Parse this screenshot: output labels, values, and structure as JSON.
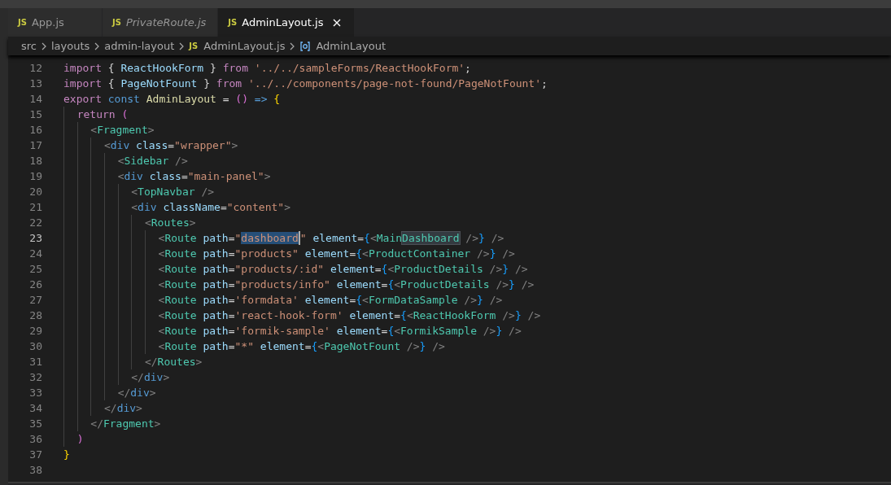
{
  "tabs": [
    {
      "icon_text": "JS",
      "label": "App.js",
      "selected": false,
      "preview": false
    },
    {
      "icon_text": "JS",
      "label": "PrivateRoute.js",
      "selected": false,
      "preview": true
    },
    {
      "icon_text": "JS",
      "label": "AdminLayout.js",
      "selected": true,
      "preview": false
    }
  ],
  "breadcrumb": [
    {
      "kind": "folder",
      "label": "src"
    },
    {
      "kind": "folder",
      "label": "layouts"
    },
    {
      "kind": "folder",
      "label": "admin-layout"
    },
    {
      "kind": "file",
      "icon_text": "JS",
      "label": "AdminLayout.js"
    },
    {
      "kind": "symbol",
      "label": "AdminLayout"
    }
  ],
  "code": {
    "lines": [
      {
        "number": "12",
        "active": false,
        "tokens": [
          {
            "kind": "kw",
            "text": "import"
          },
          {
            "kind": "punct",
            "text": " { "
          },
          {
            "kind": "var",
            "text": "ReactHookForm"
          },
          {
            "kind": "punct",
            "text": " } "
          },
          {
            "kind": "kw",
            "text": "from"
          },
          {
            "kind": "str",
            "text": " '../../sampleForms/ReactHookForm'"
          },
          {
            "kind": "punct",
            "text": ";"
          }
        ]
      },
      {
        "number": "13",
        "active": false,
        "tokens": [
          {
            "kind": "kw",
            "text": "import"
          },
          {
            "kind": "punct",
            "text": " { "
          },
          {
            "kind": "var",
            "text": "PageNotFount"
          },
          {
            "kind": "punct",
            "text": " } "
          },
          {
            "kind": "kw",
            "text": "from"
          },
          {
            "kind": "str",
            "text": " '../../components/page-not-found/PageNotFount'"
          },
          {
            "kind": "punct",
            "text": ";"
          }
        ]
      },
      {
        "number": "14",
        "active": false,
        "tokens": [
          {
            "kind": "kw",
            "text": "export"
          },
          {
            "kind": "storage",
            "text": " const"
          },
          {
            "kind": "fn",
            "text": " AdminLayout"
          },
          {
            "kind": "punct",
            "text": " = "
          },
          {
            "kind": "b2",
            "text": "()"
          },
          {
            "kind": "storage",
            "text": " =>"
          },
          {
            "kind": "b1",
            "text": " {"
          }
        ]
      },
      {
        "number": "15",
        "active": false,
        "tokens": [
          {
            "kind": "kw",
            "text": "  return"
          },
          {
            "kind": "b2",
            "text": " ("
          }
        ]
      },
      {
        "number": "16",
        "active": false,
        "tokens": [
          {
            "kind": "angle",
            "text": "    <"
          },
          {
            "kind": "comp",
            "text": "Fragment"
          },
          {
            "kind": "angle",
            "text": ">"
          }
        ]
      },
      {
        "number": "17",
        "active": false,
        "tokens": [
          {
            "kind": "angle",
            "text": "      <"
          },
          {
            "kind": "html",
            "text": "div"
          },
          {
            "kind": "attr",
            "text": " class"
          },
          {
            "kind": "punct",
            "text": "="
          },
          {
            "kind": "str",
            "text": "\"wrapper\""
          },
          {
            "kind": "angle",
            "text": ">"
          }
        ]
      },
      {
        "number": "18",
        "active": false,
        "tokens": [
          {
            "kind": "angle",
            "text": "        <"
          },
          {
            "kind": "comp",
            "text": "Sidebar"
          },
          {
            "kind": "angle",
            "text": " />"
          }
        ]
      },
      {
        "number": "19",
        "active": false,
        "tokens": [
          {
            "kind": "angle",
            "text": "        <"
          },
          {
            "kind": "html",
            "text": "div"
          },
          {
            "kind": "attr",
            "text": " class"
          },
          {
            "kind": "punct",
            "text": "="
          },
          {
            "kind": "str",
            "text": "\"main-panel\""
          },
          {
            "kind": "angle",
            "text": ">"
          }
        ]
      },
      {
        "number": "20",
        "active": false,
        "tokens": [
          {
            "kind": "angle",
            "text": "          <"
          },
          {
            "kind": "comp",
            "text": "TopNavbar"
          },
          {
            "kind": "angle",
            "text": " />"
          }
        ]
      },
      {
        "number": "21",
        "active": false,
        "tokens": [
          {
            "kind": "angle",
            "text": "          <"
          },
          {
            "kind": "html",
            "text": "div"
          },
          {
            "kind": "attr",
            "text": " className"
          },
          {
            "kind": "punct",
            "text": "="
          },
          {
            "kind": "str",
            "text": "\"content\""
          },
          {
            "kind": "angle",
            "text": ">"
          }
        ]
      },
      {
        "number": "22",
        "active": false,
        "tokens": [
          {
            "kind": "angle",
            "text": "            <"
          },
          {
            "kind": "comp",
            "text": "Routes"
          },
          {
            "kind": "angle",
            "text": ">"
          }
        ]
      },
      {
        "number": "23",
        "active": true,
        "tokens": [
          {
            "kind": "angle",
            "text": "              <"
          },
          {
            "kind": "comp",
            "text": "Route"
          },
          {
            "kind": "attr",
            "text": " path"
          },
          {
            "kind": "punct",
            "text": "="
          },
          {
            "kind": "str",
            "text": "\""
          },
          {
            "kind": "str",
            "text": "dashboard",
            "selected": true
          },
          {
            "kind": "str",
            "text": "\""
          },
          {
            "kind": "attr",
            "text": " element"
          },
          {
            "kind": "punct",
            "text": "="
          },
          {
            "kind": "b3",
            "text": "{"
          },
          {
            "kind": "angle",
            "text": "<"
          },
          {
            "kind": "comp",
            "text": "Main"
          },
          {
            "kind": "comp",
            "text": "Dashboard",
            "word_match": true
          },
          {
            "kind": "angle",
            "text": " />"
          },
          {
            "kind": "b3",
            "text": "}"
          },
          {
            "kind": "angle",
            "text": " />"
          }
        ]
      },
      {
        "number": "24",
        "active": false,
        "tokens": [
          {
            "kind": "angle",
            "text": "              <"
          },
          {
            "kind": "comp",
            "text": "Route"
          },
          {
            "kind": "attr",
            "text": " path"
          },
          {
            "kind": "punct",
            "text": "="
          },
          {
            "kind": "str",
            "text": "\"products\""
          },
          {
            "kind": "attr",
            "text": " element"
          },
          {
            "kind": "punct",
            "text": "="
          },
          {
            "kind": "b3",
            "text": "{"
          },
          {
            "kind": "angle",
            "text": "<"
          },
          {
            "kind": "comp",
            "text": "ProductContainer"
          },
          {
            "kind": "angle",
            "text": " />"
          },
          {
            "kind": "b3",
            "text": "}"
          },
          {
            "kind": "angle",
            "text": " />"
          }
        ]
      },
      {
        "number": "25",
        "active": false,
        "tokens": [
          {
            "kind": "angle",
            "text": "              <"
          },
          {
            "kind": "comp",
            "text": "Route"
          },
          {
            "kind": "attr",
            "text": " path"
          },
          {
            "kind": "punct",
            "text": "="
          },
          {
            "kind": "str",
            "text": "\"products/:id\""
          },
          {
            "kind": "attr",
            "text": " element"
          },
          {
            "kind": "punct",
            "text": "="
          },
          {
            "kind": "b3",
            "text": "{"
          },
          {
            "kind": "angle",
            "text": "<"
          },
          {
            "kind": "comp",
            "text": "ProductDetails"
          },
          {
            "kind": "angle",
            "text": " />"
          },
          {
            "kind": "b3",
            "text": "}"
          },
          {
            "kind": "angle",
            "text": " />"
          }
        ]
      },
      {
        "number": "26",
        "active": false,
        "tokens": [
          {
            "kind": "angle",
            "text": "              <"
          },
          {
            "kind": "comp",
            "text": "Route"
          },
          {
            "kind": "attr",
            "text": " path"
          },
          {
            "kind": "punct",
            "text": "="
          },
          {
            "kind": "str",
            "text": "\"products/info\""
          },
          {
            "kind": "attr",
            "text": " element"
          },
          {
            "kind": "punct",
            "text": "="
          },
          {
            "kind": "b3",
            "text": "{"
          },
          {
            "kind": "angle",
            "text": "<"
          },
          {
            "kind": "comp",
            "text": "ProductDetails"
          },
          {
            "kind": "angle",
            "text": " />"
          },
          {
            "kind": "b3",
            "text": "}"
          },
          {
            "kind": "angle",
            "text": " />"
          }
        ]
      },
      {
        "number": "27",
        "active": false,
        "tokens": [
          {
            "kind": "angle",
            "text": "              <"
          },
          {
            "kind": "comp",
            "text": "Route"
          },
          {
            "kind": "attr",
            "text": " path"
          },
          {
            "kind": "punct",
            "text": "="
          },
          {
            "kind": "str",
            "text": "'formdata'"
          },
          {
            "kind": "attr",
            "text": " element"
          },
          {
            "kind": "punct",
            "text": "="
          },
          {
            "kind": "b3",
            "text": "{"
          },
          {
            "kind": "angle",
            "text": "<"
          },
          {
            "kind": "comp",
            "text": "FormDataSample"
          },
          {
            "kind": "angle",
            "text": " />"
          },
          {
            "kind": "b3",
            "text": "}"
          },
          {
            "kind": "angle",
            "text": " />"
          }
        ]
      },
      {
        "number": "28",
        "active": false,
        "tokens": [
          {
            "kind": "angle",
            "text": "              <"
          },
          {
            "kind": "comp",
            "text": "Route"
          },
          {
            "kind": "attr",
            "text": " path"
          },
          {
            "kind": "punct",
            "text": "="
          },
          {
            "kind": "str",
            "text": "'react-hook-form'"
          },
          {
            "kind": "attr",
            "text": " element"
          },
          {
            "kind": "punct",
            "text": "="
          },
          {
            "kind": "b3",
            "text": "{"
          },
          {
            "kind": "angle",
            "text": "<"
          },
          {
            "kind": "comp",
            "text": "ReactHookForm"
          },
          {
            "kind": "angle",
            "text": " />"
          },
          {
            "kind": "b3",
            "text": "}"
          },
          {
            "kind": "angle",
            "text": " />"
          }
        ]
      },
      {
        "number": "29",
        "active": false,
        "tokens": [
          {
            "kind": "angle",
            "text": "              <"
          },
          {
            "kind": "comp",
            "text": "Route"
          },
          {
            "kind": "attr",
            "text": " path"
          },
          {
            "kind": "punct",
            "text": "="
          },
          {
            "kind": "str",
            "text": "'formik-sample'"
          },
          {
            "kind": "attr",
            "text": " element"
          },
          {
            "kind": "punct",
            "text": "="
          },
          {
            "kind": "b3",
            "text": "{"
          },
          {
            "kind": "angle",
            "text": "<"
          },
          {
            "kind": "comp",
            "text": "FormikSample"
          },
          {
            "kind": "angle",
            "text": " />"
          },
          {
            "kind": "b3",
            "text": "}"
          },
          {
            "kind": "angle",
            "text": " />"
          }
        ]
      },
      {
        "number": "30",
        "active": false,
        "tokens": [
          {
            "kind": "angle",
            "text": "              <"
          },
          {
            "kind": "comp",
            "text": "Route"
          },
          {
            "kind": "attr",
            "text": " path"
          },
          {
            "kind": "punct",
            "text": "="
          },
          {
            "kind": "str",
            "text": "\"*\""
          },
          {
            "kind": "attr",
            "text": " element"
          },
          {
            "kind": "punct",
            "text": "="
          },
          {
            "kind": "b3",
            "text": "{"
          },
          {
            "kind": "angle",
            "text": "<"
          },
          {
            "kind": "comp",
            "text": "PageNotFount"
          },
          {
            "kind": "angle",
            "text": " />"
          },
          {
            "kind": "b3",
            "text": "}"
          },
          {
            "kind": "angle",
            "text": " />"
          }
        ]
      },
      {
        "number": "31",
        "active": false,
        "tokens": [
          {
            "kind": "angle",
            "text": "            </"
          },
          {
            "kind": "comp",
            "text": "Routes"
          },
          {
            "kind": "angle",
            "text": ">"
          }
        ]
      },
      {
        "number": "32",
        "active": false,
        "tokens": [
          {
            "kind": "angle",
            "text": "          </"
          },
          {
            "kind": "html",
            "text": "div"
          },
          {
            "kind": "angle",
            "text": ">"
          }
        ]
      },
      {
        "number": "33",
        "active": false,
        "tokens": [
          {
            "kind": "angle",
            "text": "        </"
          },
          {
            "kind": "html",
            "text": "div"
          },
          {
            "kind": "angle",
            "text": ">"
          }
        ]
      },
      {
        "number": "34",
        "active": false,
        "tokens": [
          {
            "kind": "angle",
            "text": "      </"
          },
          {
            "kind": "html",
            "text": "div"
          },
          {
            "kind": "angle",
            "text": ">"
          }
        ]
      },
      {
        "number": "35",
        "active": false,
        "tokens": [
          {
            "kind": "angle",
            "text": "    </"
          },
          {
            "kind": "comp",
            "text": "Fragment"
          },
          {
            "kind": "angle",
            "text": ">"
          }
        ]
      },
      {
        "number": "36",
        "active": false,
        "tokens": [
          {
            "kind": "b2",
            "text": "  )"
          }
        ]
      },
      {
        "number": "37",
        "active": false,
        "tokens": [
          {
            "kind": "b1",
            "text": "}"
          }
        ]
      },
      {
        "number": "38",
        "active": false
      }
    ]
  }
}
